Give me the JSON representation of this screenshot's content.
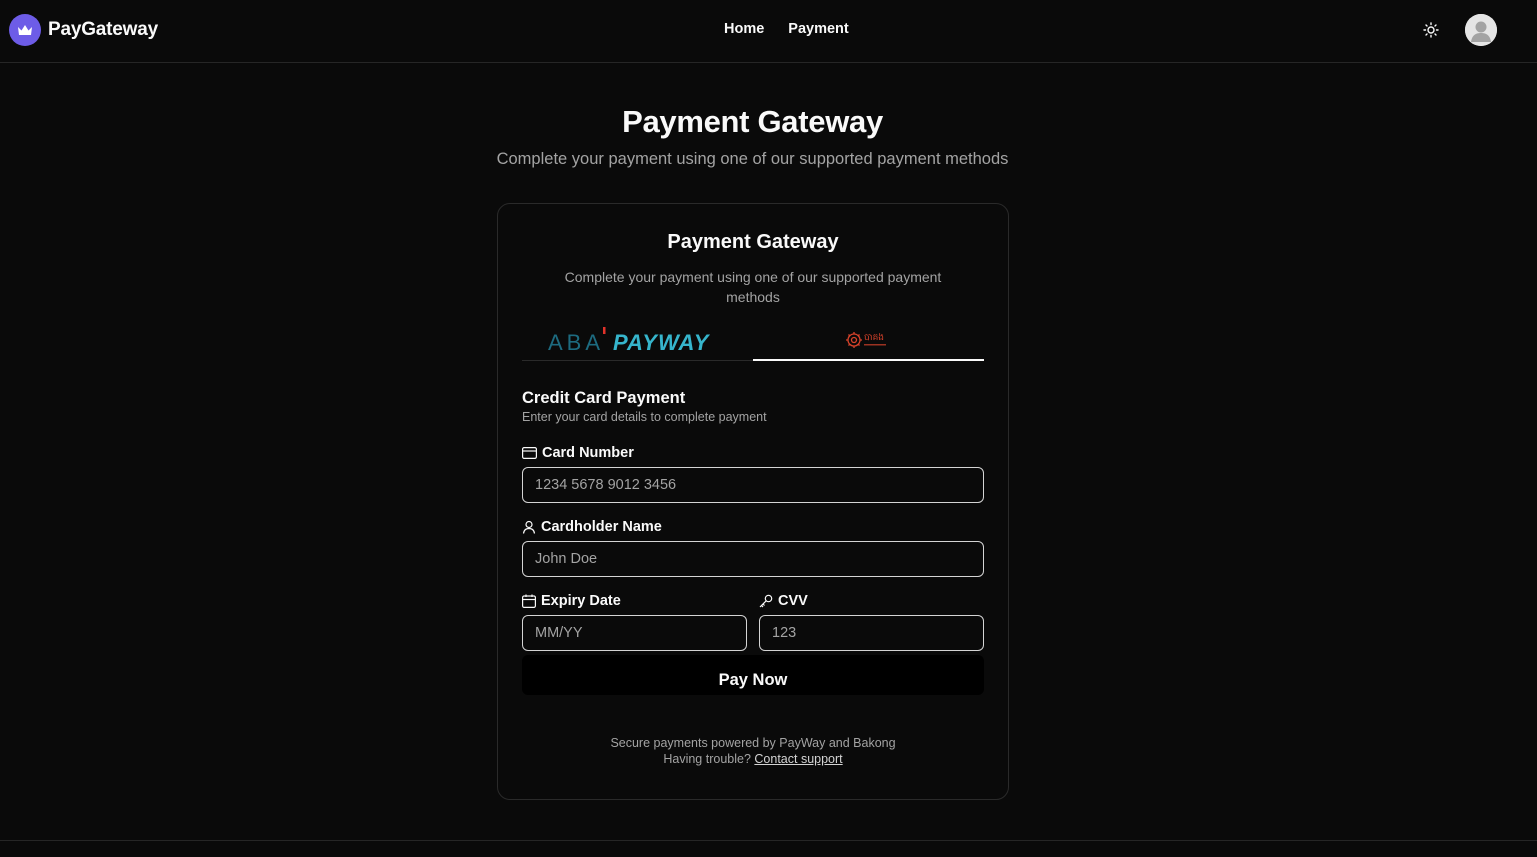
{
  "navbar": {
    "brand": "PayGateway",
    "links": [
      "Home",
      "Payment"
    ]
  },
  "page": {
    "title": "Payment Gateway",
    "subtitle": "Complete your payment using one of our supported payment methods"
  },
  "card": {
    "title": "Payment Gateway",
    "subtitle": "Complete your payment using one of our supported payment methods",
    "tabs": {
      "payway_logo_text_left": "ABA",
      "payway_logo_text_right": "PAYWAY",
      "bakong_logo_text": "បាគង",
      "active_tab": "bakong"
    },
    "section": {
      "title": "Credit Card Payment",
      "description": "Enter your card details to complete payment"
    },
    "fields": {
      "card_number": {
        "label": "Card Number",
        "placeholder": "1234 5678 9012 3456"
      },
      "cardholder_name": {
        "label": "Cardholder Name",
        "placeholder": "John Doe"
      },
      "expiry_date": {
        "label": "Expiry Date",
        "placeholder": "MM/YY"
      },
      "cvv": {
        "label": "CVV",
        "placeholder": "123"
      }
    },
    "pay_button": "Pay Now",
    "footer": {
      "line1": "Secure payments powered by PayWay and Bakong",
      "line2_prefix": "Having trouble?",
      "support_link": "Contact support"
    }
  },
  "colors": {
    "background": "#0a0a0a",
    "brand_accent": "#6d5ce7",
    "payway_teal_dark": "#1d6b80",
    "payway_teal_light": "#36b5cc",
    "bakong_red": "#d8432b"
  },
  "icons": {
    "brand": "crown-icon",
    "theme_toggle": "sun-icon",
    "avatar": "user-avatar-icon",
    "card_number": "credit-card-icon",
    "cardholder_name": "user-icon",
    "expiry_date": "calendar-icon",
    "cvv": "key-icon"
  }
}
